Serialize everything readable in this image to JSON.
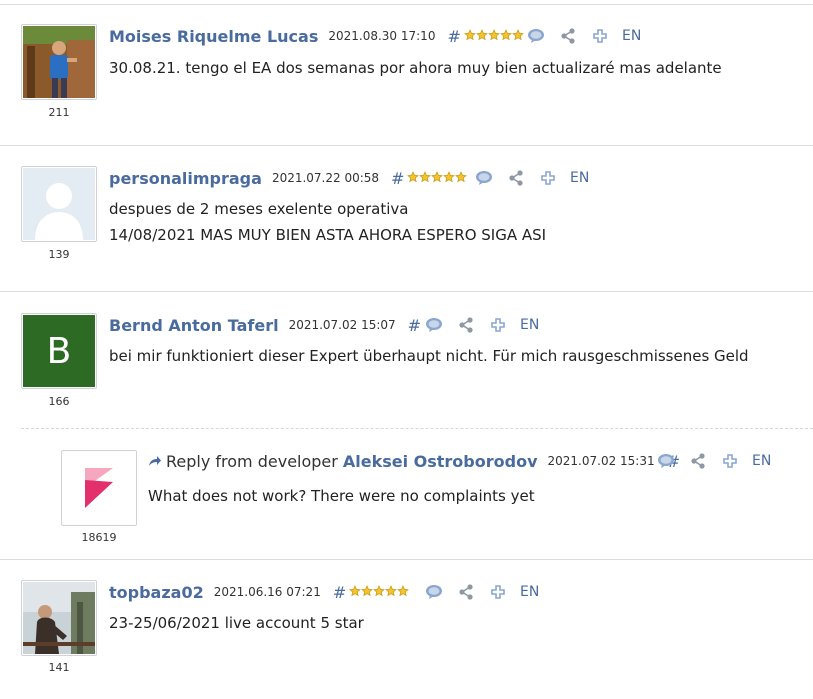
{
  "labels": {
    "reply_from_developer": "Reply from developer",
    "hash": "#",
    "lang": "EN"
  },
  "colors": {
    "link": "#4a6b9d",
    "star_fill": "#f4c430",
    "star_stroke": "#c99a18",
    "icon_blue": "#8aa6cf",
    "icon_gray": "#8e98a4",
    "avatar_green": "#2d6a23"
  },
  "reviews": [
    {
      "author": "Moises Riquelme Lucas",
      "date": "2021.08.30 17:10",
      "rating_count": "211",
      "stars": 5,
      "lines": [
        "30.08.21. tengo el EA dos semanas por ahora muy bien actualizaré mas adelante"
      ]
    },
    {
      "author": "personalimpraga",
      "date": "2021.07.22 00:58",
      "rating_count": "139",
      "stars": 5,
      "lines": [
        "despues de 2 meses exelente operativa",
        "14/08/2021 MAS MUY BIEN ASTA AHORA ESPERO SIGA ASI"
      ]
    },
    {
      "author": "Bernd Anton Taferl",
      "date": "2021.07.02 15:07",
      "rating_count": "166",
      "avatar_letter": "B",
      "stars": 0,
      "lines": [
        "bei mir funktioniert dieser Expert überhaupt nicht. Für mich rausgeschmissenes Geld"
      ]
    },
    {
      "author": "topbaza02",
      "date": "2021.06.16 07:21",
      "rating_count": "141",
      "stars": 5,
      "lines": [
        "23-25/06/2021 live account 5 star"
      ]
    }
  ],
  "reply": {
    "developer": "Aleksei Ostroborodov",
    "date": "2021.07.02 15:31",
    "rating_count": "18619",
    "lines": [
      "What does not work? There were no complaints yet"
    ]
  }
}
